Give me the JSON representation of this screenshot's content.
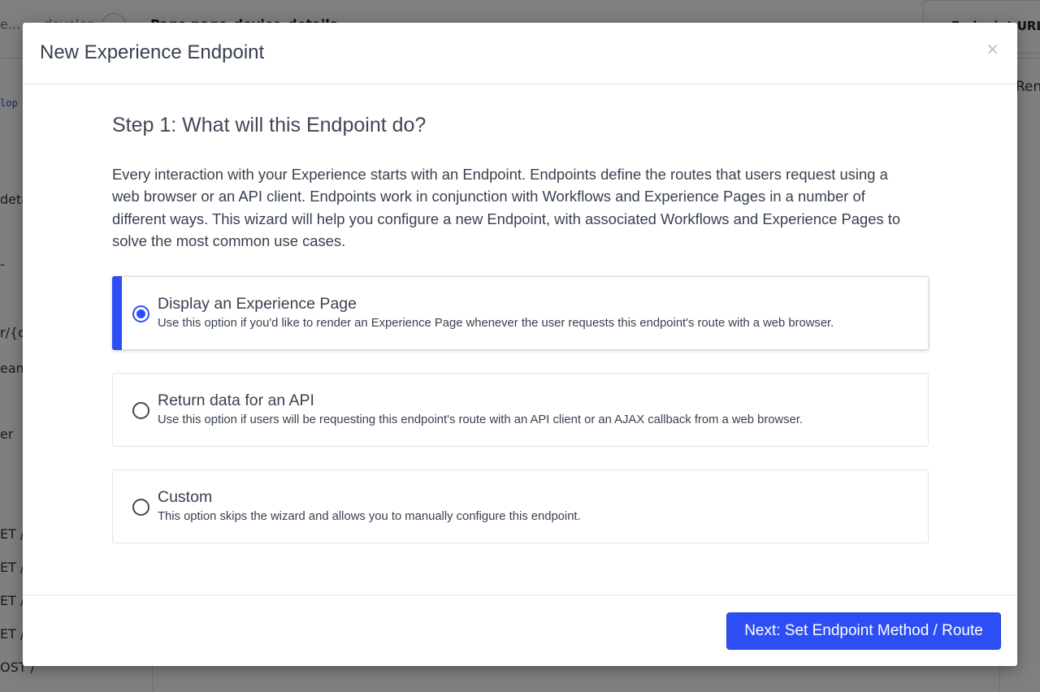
{
  "background": {
    "breadcrumb_prefix": "e...",
    "breadcrumb_sep": "›",
    "breadcrumb_project": "develop",
    "breadcrumb_page": "Page page_device_details",
    "endpoint_url_label": "Endpoint URL:",
    "right_tab_label": "Ren",
    "sidebar_items": [
      {
        "text": "lop",
        "kind": "link"
      },
      {
        "text": "deta"
      },
      {
        "text": "-"
      },
      {
        "text": "r/{d"
      },
      {
        "text": "eam"
      },
      {
        "text": "er"
      },
      {
        "text": "ET /"
      },
      {
        "text": "ET /"
      },
      {
        "text": "ET /"
      },
      {
        "text": "ET /"
      },
      {
        "text": "OST /"
      }
    ]
  },
  "modal": {
    "title": "New Experience Endpoint",
    "close_label": "×",
    "step_title": "Step 1: What will this Endpoint do?",
    "intro": "Every interaction with your Experience starts with an Endpoint. Endpoints define the routes that users request using a web browser or an API client. Endpoints work in conjunction with Workflows and Experience Pages in a number of different ways. This wizard will help you configure a new Endpoint, with associated Workflows and Experience Pages to solve the most common use cases.",
    "options": [
      {
        "title": "Display an Experience Page",
        "description": "Use this option if you'd like to render an Experience Page whenever the user requests this endpoint's route with a web browser.",
        "selected": true
      },
      {
        "title": "Return data for an API",
        "description": "Use this option if users will be requesting this endpoint's route with an API client or an AJAX callback from a web browser.",
        "selected": false
      },
      {
        "title": "Custom",
        "description": "This option skips the wizard and allows you to manually configure this endpoint.",
        "selected": false
      }
    ],
    "next_button": "Next: Set Endpoint Method / Route"
  },
  "colors": {
    "accent": "#2d4ef5",
    "text": "#384150",
    "overlay": "rgba(0,0,0,0.5)"
  }
}
